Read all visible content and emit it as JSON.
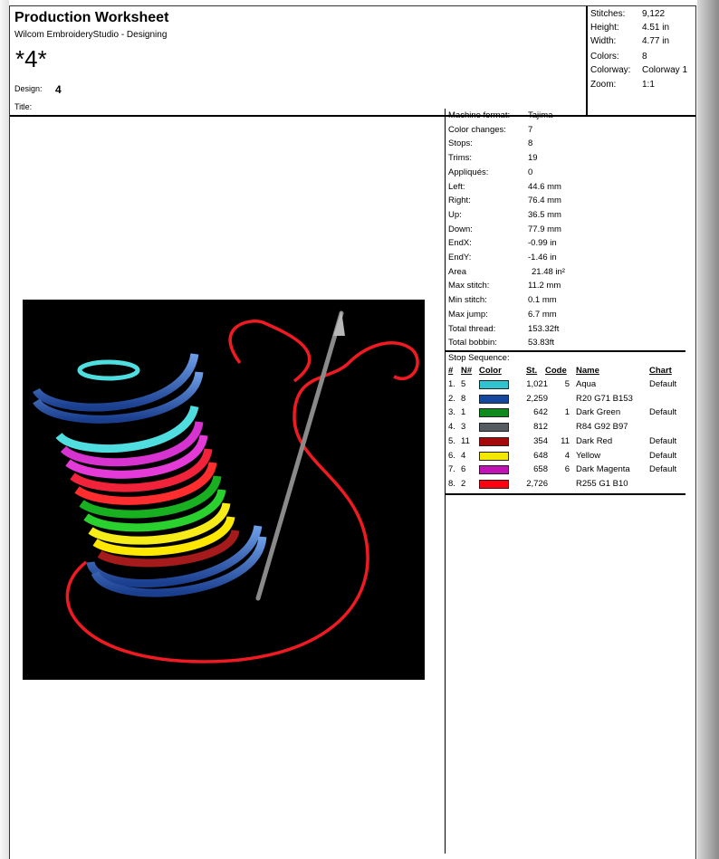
{
  "header": {
    "title": "Production Worksheet",
    "subtitle": "Wilcom EmbroideryStudio - Designing",
    "design_big": "*4*",
    "design_label": "Design:",
    "design_value": "4",
    "title_label": "Title:"
  },
  "stats": [
    {
      "label": "Stitches:",
      "value": "9,122"
    },
    {
      "label": "Height:",
      "value": "4.51 in"
    },
    {
      "label": "Width:",
      "value": "4.77 in"
    },
    {
      "label": "Colors:",
      "value": "8"
    },
    {
      "label": "Colorway:",
      "value": "Colorway 1"
    },
    {
      "label": "Zoom:",
      "value": "1:1"
    }
  ],
  "specs": [
    {
      "label": "Machine format:",
      "value": "Tajima"
    },
    {
      "label": "Color changes:",
      "value": "7"
    },
    {
      "label": "Stops:",
      "value": "8"
    },
    {
      "label": "Trims:",
      "value": "19"
    },
    {
      "label": "Appliqués:",
      "value": "0"
    },
    {
      "label": "Left:",
      "value": "44.6 mm"
    },
    {
      "label": "Right:",
      "value": "76.4 mm"
    },
    {
      "label": "Up:",
      "value": "36.5 mm"
    },
    {
      "label": "Down:",
      "value": "77.9 mm"
    },
    {
      "label": "EndX:",
      "value": "-0.99 in"
    },
    {
      "label": "EndY:",
      "value": "-1.46 in"
    },
    {
      "label": "Area",
      "value": "21.48 in²"
    },
    {
      "label": "Max stitch:",
      "value": "11.2 mm"
    },
    {
      "label": "Min stitch:",
      "value": "0.1 mm"
    },
    {
      "label": "Max jump:",
      "value": "6.7 mm"
    },
    {
      "label": "Total thread:",
      "value": "153.32ft"
    },
    {
      "label": "Total bobbin:",
      "value": "53.83ft"
    }
  ],
  "sequence": {
    "title": "Stop Sequence:",
    "headers": {
      "num": "#",
      "n": "N#",
      "color": "Color",
      "st": "St.",
      "code": "Code",
      "name": "Name",
      "chart": "Chart"
    },
    "rows": [
      {
        "num": "1.",
        "n": "5",
        "color": "#2fc4cf",
        "st": "1,021",
        "code": "5",
        "name": "Aqua",
        "chart": "Default"
      },
      {
        "num": "2.",
        "n": "8",
        "color": "#1447a0",
        "st": "2,259",
        "code": "",
        "name": "R20 G71 B153",
        "chart": ""
      },
      {
        "num": "3.",
        "n": "1",
        "color": "#0e8a1e",
        "st": "642",
        "code": "1",
        "name": "Dark Green",
        "chart": "Default"
      },
      {
        "num": "4.",
        "n": "3",
        "color": "#545c61",
        "st": "812",
        "code": "",
        "name": "R84 G92 B97",
        "chart": ""
      },
      {
        "num": "5.",
        "n": "11",
        "color": "#a50a0a",
        "st": "354",
        "code": "11",
        "name": "Dark Red",
        "chart": "Default"
      },
      {
        "num": "6.",
        "n": "4",
        "color": "#f5e800",
        "st": "648",
        "code": "4",
        "name": "Yellow",
        "chart": "Default"
      },
      {
        "num": "7.",
        "n": "6",
        "color": "#c012b5",
        "st": "658",
        "code": "6",
        "name": "Dark Magenta",
        "chart": "Default"
      },
      {
        "num": "8.",
        "n": "2",
        "color": "#ff0110",
        "st": "2,726",
        "code": "",
        "name": "R255 G1 B10",
        "chart": ""
      }
    ]
  }
}
